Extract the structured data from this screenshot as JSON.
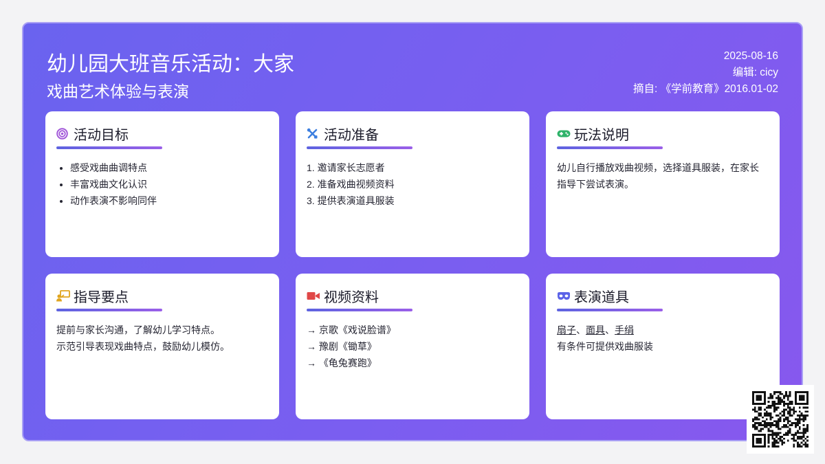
{
  "header": {
    "title_line1": "幼儿园大班音乐活动：大家",
    "title_line2": "戏曲艺术体验与表演",
    "date": "2025-08-16",
    "editor": "编辑: cicy",
    "source": "摘自: 《学前教育》2016.01-02"
  },
  "cards": {
    "goals": {
      "title": "活动目标",
      "icon": "target-icon",
      "items": [
        "感受戏曲曲调特点",
        "丰富戏曲文化认识",
        "动作表演不影响同伴"
      ]
    },
    "prep": {
      "title": "活动准备",
      "icon": "tools-icon",
      "items": [
        "1. 邀请家长志愿者",
        "2. 准备戏曲视频资料",
        "3. 提供表演道具服装"
      ]
    },
    "play": {
      "title": "玩法说明",
      "icon": "gamepad-icon",
      "text": "幼儿自行播放戏曲视频，选择道具服装，在家长指导下尝试表演。"
    },
    "guide": {
      "title": "指导要点",
      "icon": "teacher-board-icon",
      "lines": [
        "提前与家长沟通，了解幼儿学习特点。",
        "示范引导表现戏曲特点，鼓励幼儿模仿。"
      ]
    },
    "video": {
      "title": "视频资料",
      "icon": "video-camera-icon",
      "items": [
        "→ 京歌《戏说脸谱》",
        "→ 豫剧《锄草》",
        "→ 《龟兔赛跑》"
      ]
    },
    "props": {
      "title": "表演道具",
      "icon": "mask-icon",
      "links": [
        "扇子",
        "面具",
        "手绢"
      ],
      "separator": "、",
      "note": "有条件可提供戏曲服装"
    }
  },
  "colors": {
    "bg_start": "#6a63ef",
    "bg_end": "#8758ee",
    "accent_underline_start": "#5d63e0",
    "accent_underline_end": "#9a5fe8"
  }
}
